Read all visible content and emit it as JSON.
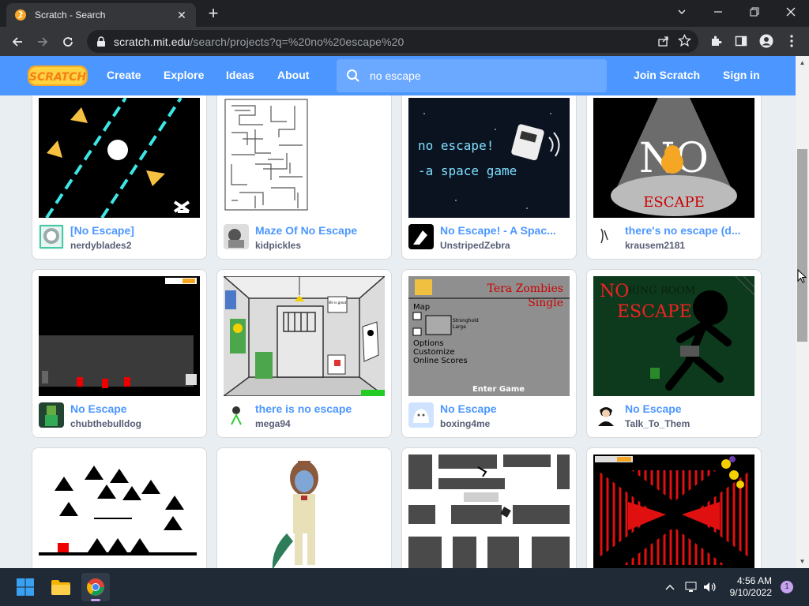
{
  "browser": {
    "tab_title": "Scratch - Search",
    "url_host": "scratch.mit.edu",
    "url_path": "/search/projects?q=%20no%20escape%20"
  },
  "nav": {
    "create": "Create",
    "explore": "Explore",
    "ideas": "Ideas",
    "about": "About",
    "search_value": "no escape",
    "join": "Join Scratch",
    "signin": "Sign in"
  },
  "projects": [
    {
      "title": "[No Escape]",
      "author": "nerdyblades2"
    },
    {
      "title": "Maze Of No Escape",
      "author": "kidpickles"
    },
    {
      "title": "No Escape! - A Spac...",
      "author": "UnstripedZebra"
    },
    {
      "title": "there's no escape (d...",
      "author": "krausem2181"
    },
    {
      "title": "No Escape",
      "author": "chubthebulldog"
    },
    {
      "title": "there is no escape",
      "author": "mega94"
    },
    {
      "title": "No Escape",
      "author": "boxing4me"
    },
    {
      "title": "No Escape",
      "author": "Talk_To_Them"
    },
    {
      "title": "",
      "author": ""
    },
    {
      "title": "",
      "author": ""
    },
    {
      "title": "",
      "author": ""
    },
    {
      "title": "",
      "author": ""
    }
  ],
  "thumb_text": {
    "space_line1": "no escape!",
    "space_line2": "-a space game",
    "no_big": "NO",
    "escape_red": "ESCAPE",
    "life_is_great": "life is great",
    "tera_zombies": "Tera Zombies",
    "single": "Single",
    "map": "Map",
    "stronghold": "Stronghold",
    "large": "Large",
    "options": "Options",
    "customize": "Customize",
    "online_scores": "Online Scores",
    "enter_game": "Enter Game",
    "no_red": "NO",
    "escape_red2": "ESCAPE",
    "ring_room": "RING ROOM"
  },
  "taskbar": {
    "time": "4:56 AM",
    "date": "9/10/2022",
    "notifications": "1"
  },
  "colors": {
    "scratch_blue": "#4c97ff",
    "title_blue": "#4c97ff",
    "author_gray": "#575e75",
    "chrome_dark": "#202124",
    "chrome_toolbar": "#35363a"
  }
}
